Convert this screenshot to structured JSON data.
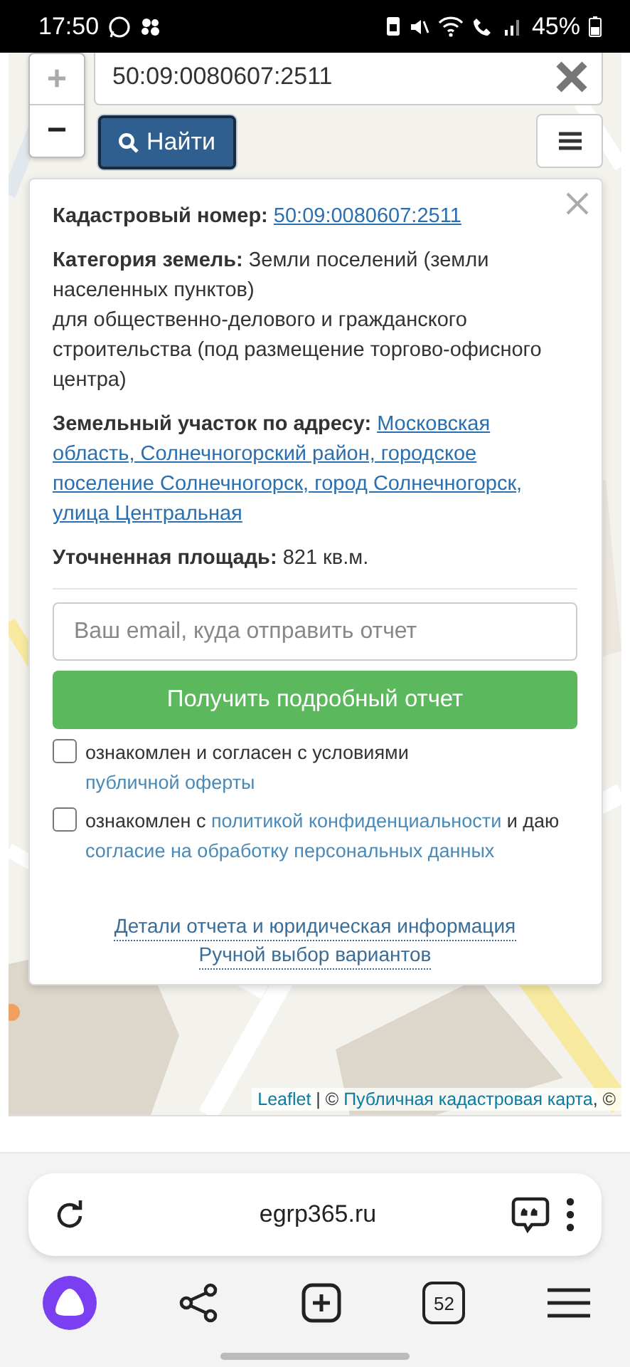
{
  "status_bar": {
    "time": "17:50",
    "battery": "45%"
  },
  "map": {
    "search": {
      "value": "50:09:0080607:2511"
    },
    "zoom_in": "+",
    "zoom_out": "−",
    "find_button": "Найти",
    "popup": {
      "fields": [
        {
          "label": "Кадастровый номер:",
          "value": "50:09:0080607:2511",
          "kind": "link"
        },
        {
          "label": "Категория земель:",
          "value": "Земли поселений (земли населенных пунктов)",
          "details": "для общественно-делового и гражданского строительства (под размещение торгово-офисного центра)",
          "kind": "text"
        },
        {
          "label": "Земельный участок по адресу:",
          "value": "Московская область, Солнечногорский район, городское поселение Солнечногорск, город Солнечногорск, улица Центральная",
          "kind": "link"
        },
        {
          "label": "Уточненная площадь:",
          "value": "821 кв.м.",
          "kind": "text"
        }
      ],
      "email": {
        "placeholder": "Ваш email, куда отправить отчет"
      },
      "submit_button": "Получить подробный отчет",
      "consents": [
        {
          "checked": false,
          "parts": [
            {
              "text": "ознакомлен и согласен с условиями ",
              "kind": "text"
            },
            {
              "text": "публичной оферты",
              "kind": "link"
            }
          ]
        },
        {
          "checked": false,
          "parts": [
            {
              "text": "ознакомлен с ",
              "kind": "text"
            },
            {
              "text": "политикой конфиденциальности",
              "kind": "link"
            },
            {
              "text": " и даю ",
              "kind": "text"
            },
            {
              "text": "согласие на обработку персональных данных",
              "kind": "link"
            }
          ]
        }
      ],
      "footer_links": [
        "Детали отчета и юридическая информация",
        "Ручной выбор вариантов"
      ]
    },
    "attribution": [
      {
        "text": "Leaflet",
        "kind": "link"
      },
      {
        "text": " | © ",
        "kind": "text"
      },
      {
        "text": "Публичная кадастровая карта",
        "kind": "link"
      },
      {
        "text": ", ©",
        "kind": "text"
      }
    ]
  },
  "browser": {
    "url": "egrp365.ru",
    "tab_count": "52"
  }
}
